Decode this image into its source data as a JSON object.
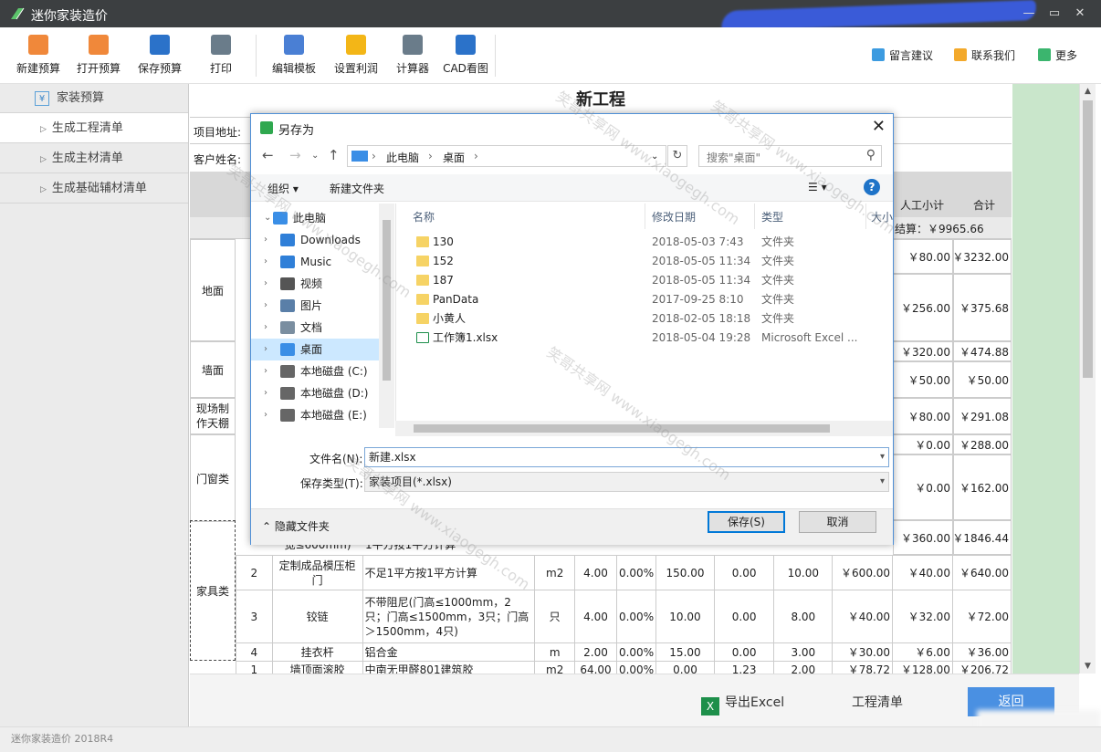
{
  "app": {
    "title": "迷你家装造价",
    "version": "迷你家装造价 2018R4"
  },
  "toolbar": {
    "items": [
      {
        "label": "新建预算",
        "icon": "new-file-icon",
        "color": "#f0883a"
      },
      {
        "label": "打开预算",
        "icon": "open-file-icon",
        "color": "#f0883a"
      },
      {
        "label": "保存预算",
        "icon": "save-icon",
        "color": "#2b72c9"
      },
      {
        "label": "打印",
        "icon": "print-icon",
        "color": "#6a7c8a"
      },
      {
        "label": "编辑模板",
        "icon": "edit-template-icon",
        "color": "#4a7fd4"
      },
      {
        "label": "设置利润",
        "icon": "profit-icon",
        "color": "#f3b617"
      },
      {
        "label": "计算器",
        "icon": "calculator-icon",
        "color": "#6a7c8a"
      },
      {
        "label": "CAD看图",
        "icon": "dwg-icon",
        "color": "#2b72c9"
      }
    ],
    "right": [
      {
        "label": "留言建议",
        "icon": "message-icon",
        "color": "#3c9be0"
      },
      {
        "label": "联系我们",
        "icon": "mail-icon",
        "color": "#f3a92b"
      },
      {
        "label": "更多",
        "icon": "more-icon",
        "color": "#3bb56e"
      }
    ]
  },
  "sidebar": {
    "header": "家装预算",
    "items": [
      {
        "label": "生成工程清单"
      },
      {
        "label": "生成主材清单"
      },
      {
        "label": "生成基础辅材清单"
      }
    ]
  },
  "main": {
    "title": "新工程",
    "project_address_label": "项目地址:",
    "customer_label": "客户姓名:",
    "col_labor": "人工小计",
    "col_total": "合计",
    "settlement": "结算：￥9965.66",
    "categories": [
      "地面",
      "墙面",
      "现场制作天棚",
      "门窗类",
      "家具类"
    ],
    "right_values": [
      [
        "￥80.00",
        "￥3232.00"
      ],
      [
        "￥256.00",
        "￥375.68"
      ],
      [
        "￥320.00",
        "￥474.88"
      ],
      [
        "￥50.00",
        "￥50.00"
      ],
      [
        "￥80.00",
        "￥291.08"
      ],
      [
        "￥0.00",
        "￥288.00"
      ],
      [
        "￥0.00",
        "￥162.00"
      ],
      [
        "￥360.00",
        "￥1846.44"
      ]
    ],
    "partial_row_name": "宽≤600mm)",
    "partial_row_desc": "1平方按1平方计算",
    "rows": [
      {
        "no": "2",
        "name": "定制成品模压柜门",
        "desc": "不足1平方按1平方计算",
        "unit": "m2",
        "qty": "4.00",
        "loss": "0.00%",
        "price": "150.00",
        "c1": "0.00",
        "c2": "10.00",
        "mat": "￥600.00",
        "labor": "￥40.00",
        "total": "￥640.00"
      },
      {
        "no": "3",
        "name": "铰链",
        "desc": "不带阻尼(门高≤1000mm，2只；门高≤1500mm，3只；门高＞1500mm，4只)",
        "unit": "只",
        "qty": "4.00",
        "loss": "0.00%",
        "price": "10.00",
        "c1": "0.00",
        "c2": "8.00",
        "mat": "￥40.00",
        "labor": "￥32.00",
        "total": "￥72.00"
      },
      {
        "no": "4",
        "name": "挂衣杆",
        "desc": "铝合金",
        "unit": "m",
        "qty": "2.00",
        "loss": "0.00%",
        "price": "15.00",
        "c1": "0.00",
        "c2": "3.00",
        "mat": "￥30.00",
        "labor": "￥6.00",
        "total": "￥36.00"
      },
      {
        "no": "1",
        "name": "墙顶面滚胶",
        "desc": "中南无甲醛801建筑胶",
        "unit": "m2",
        "qty": "64.00",
        "loss": "0.00%",
        "price": "0.00",
        "c1": "1.23",
        "c2": "2.00",
        "mat": "￥78.72",
        "labor": "￥128.00",
        "total": "￥206.72"
      }
    ]
  },
  "bottom": {
    "export": "导出Excel",
    "list": "工程清单",
    "return": "返回"
  },
  "dialog": {
    "title": "另存为",
    "breadcrumb": [
      "此电脑",
      "桌面"
    ],
    "search_placeholder": "搜索\"桌面\"",
    "organize": "组织",
    "new_folder": "新建文件夹",
    "help": "?",
    "tree": [
      {
        "label": "此电脑",
        "icon": "computer-icon",
        "color": "#3a8ee6"
      },
      {
        "label": "Downloads",
        "icon": "download-icon",
        "color": "#2f7fd8"
      },
      {
        "label": "Music",
        "icon": "music-icon",
        "color": "#2f7fd8"
      },
      {
        "label": "视频",
        "icon": "video-icon",
        "color": "#555"
      },
      {
        "label": "图片",
        "icon": "picture-icon",
        "color": "#5a7fa8"
      },
      {
        "label": "文档",
        "icon": "document-icon",
        "color": "#7a8ea0"
      },
      {
        "label": "桌面",
        "icon": "desktop-icon",
        "color": "#3a8ee6"
      },
      {
        "label": "本地磁盘 (C:)",
        "icon": "drive-icon",
        "color": "#666"
      },
      {
        "label": "本地磁盘 (D:)",
        "icon": "drive-icon",
        "color": "#666"
      },
      {
        "label": "本地磁盘 (E:)",
        "icon": "drive-icon",
        "color": "#666"
      }
    ],
    "columns": {
      "name": "名称",
      "date": "修改日期",
      "type": "类型",
      "size": "大小"
    },
    "files": [
      {
        "name": "130",
        "date": "2018-05-03 7:43",
        "type": "文件夹",
        "kind": "folder"
      },
      {
        "name": "152",
        "date": "2018-05-05 11:34",
        "type": "文件夹",
        "kind": "folder"
      },
      {
        "name": "187",
        "date": "2018-05-05 11:34",
        "type": "文件夹",
        "kind": "folder"
      },
      {
        "name": "PanData",
        "date": "2017-09-25 8:10",
        "type": "文件夹",
        "kind": "folder"
      },
      {
        "name": "小黄人",
        "date": "2018-02-05 18:18",
        "type": "文件夹",
        "kind": "folder"
      },
      {
        "name": "工作簿1.xlsx",
        "date": "2018-05-04 19:28",
        "type": "Microsoft Excel ...",
        "kind": "xlsx"
      }
    ],
    "filename_label": "文件名(N):",
    "filename_value": "新建.xlsx",
    "filetype_label": "保存类型(T):",
    "filetype_value": "家装项目(*.xlsx)",
    "hide_folders": "隐藏文件夹",
    "save": "保存(S)",
    "cancel": "取消"
  },
  "watermark": {
    "cn": "笑哥共享网",
    "url": "www.xiaogegh.com"
  }
}
